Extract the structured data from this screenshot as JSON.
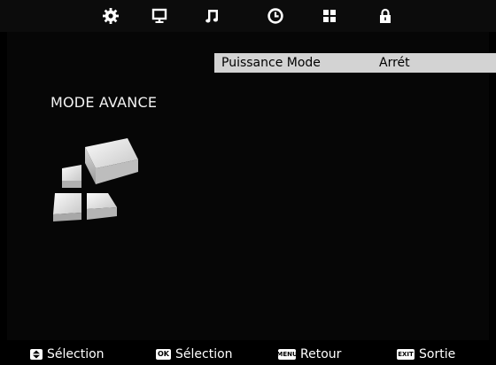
{
  "menu": {
    "tabs": [
      {
        "icon": "gear-icon",
        "active": true
      },
      {
        "icon": "monitor-icon",
        "active": false
      },
      {
        "icon": "music-note-icon",
        "active": false
      },
      {
        "icon": "clock-icon",
        "active": false
      },
      {
        "icon": "grid-icon",
        "active": false
      },
      {
        "icon": "lock-icon",
        "active": false
      }
    ]
  },
  "settings": {
    "option_label": "Puissance Mode",
    "option_value": "Arrét"
  },
  "section": {
    "title": "MODE AVANCE",
    "illustration_icon": "cube-blocks-icon"
  },
  "footer": {
    "select_updown": {
      "key": "",
      "label": "Sélection"
    },
    "select_ok": {
      "key": "OK",
      "label": "Sélection"
    },
    "back": {
      "key": "MENU",
      "label": "Retour"
    },
    "exit": {
      "key": "EXIT",
      "label": "Sortie"
    }
  },
  "colors": {
    "background": "#000000",
    "highlight_row": "#d3d3d3",
    "text": "#ffffff"
  }
}
